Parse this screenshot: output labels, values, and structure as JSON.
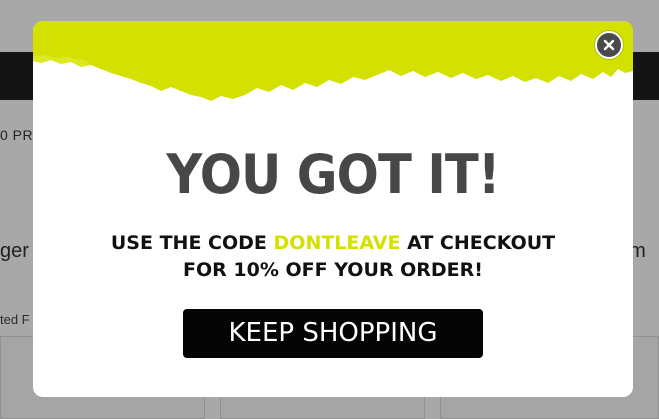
{
  "background_page": {
    "promo_text": "0 PRO",
    "heading_left": "ger",
    "heading_right": "om",
    "sort_label": "ted F"
  },
  "modal": {
    "headline": "YOU GOT IT!",
    "message_line1_before": "USE THE CODE",
    "promo_code": "DONTLEAVE",
    "message_line1_after": "AT CHECKOUT",
    "message_line2": "FOR 10% OFF YOUR ORDER!",
    "cta_label": "KEEP SHOPPING",
    "close_icon": "close-icon"
  },
  "colors": {
    "accent": "#d4e100",
    "headline": "#474747",
    "button_bg": "#050505",
    "close_bg": "#4a4a4a"
  }
}
